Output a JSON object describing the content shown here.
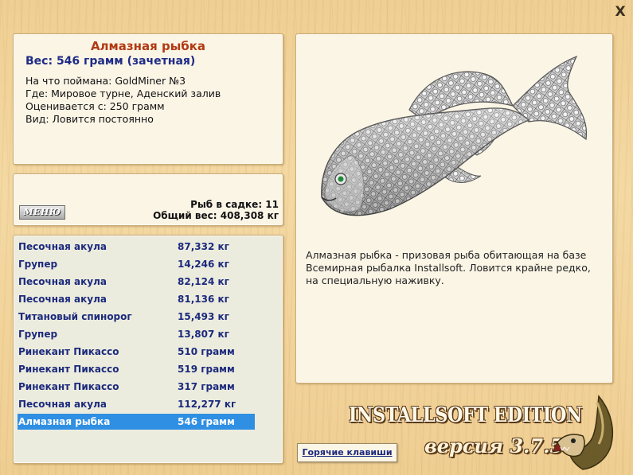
{
  "window": {
    "close_label": "X"
  },
  "info": {
    "title": "Алмазная рыбка",
    "weight": "Вес: 546 грамм (зачетная)",
    "caught_with": "На что поймана: GoldMiner №3",
    "location": "Где: Мировое турне, Аденский залив",
    "valued_from": "Оценивается с: 250 грамм",
    "type": "Вид: Ловится постоянно"
  },
  "keeper": {
    "menu_label": "МЕНЮ",
    "fish_count": "Рыб в садке: 11",
    "total_weight": "Общий вес: 408,308 кг"
  },
  "catch_list": [
    {
      "name": "Песочная акула",
      "weight": "87,332 кг"
    },
    {
      "name": "Групер",
      "weight": "14,246 кг"
    },
    {
      "name": "Песочная акула",
      "weight": "82,124 кг"
    },
    {
      "name": "Песочная акула",
      "weight": "81,136 кг"
    },
    {
      "name": "Титановый спинорог",
      "weight": "15,493 кг"
    },
    {
      "name": "Групер",
      "weight": "13,807 кг"
    },
    {
      "name": "Ринекант Пикассо",
      "weight": "510 грамм"
    },
    {
      "name": "Ринекант Пикассо",
      "weight": "519 грамм"
    },
    {
      "name": "Ринекант Пикассо",
      "weight": "317 грамм"
    },
    {
      "name": "Песочная акула",
      "weight": "112,277 кг"
    },
    {
      "name": "Алмазная рыбка",
      "weight": "546 грамм",
      "selected": true
    }
  ],
  "description": "Алмазная рыбка - призовая рыба обитающая на базе Всемирная рыбалка Installsoft. Ловится крайне редко, на специальную наживку.",
  "brand": {
    "title": "INSTALLSOFT EDITION",
    "version": "версия 3.7.5"
  },
  "hotkeys_label": "Горячие клавиши",
  "colors": {
    "title": "#b13a12",
    "weight": "#1f2b86",
    "list_text": "#1c2a7d",
    "selection": "#2f8fe3"
  }
}
